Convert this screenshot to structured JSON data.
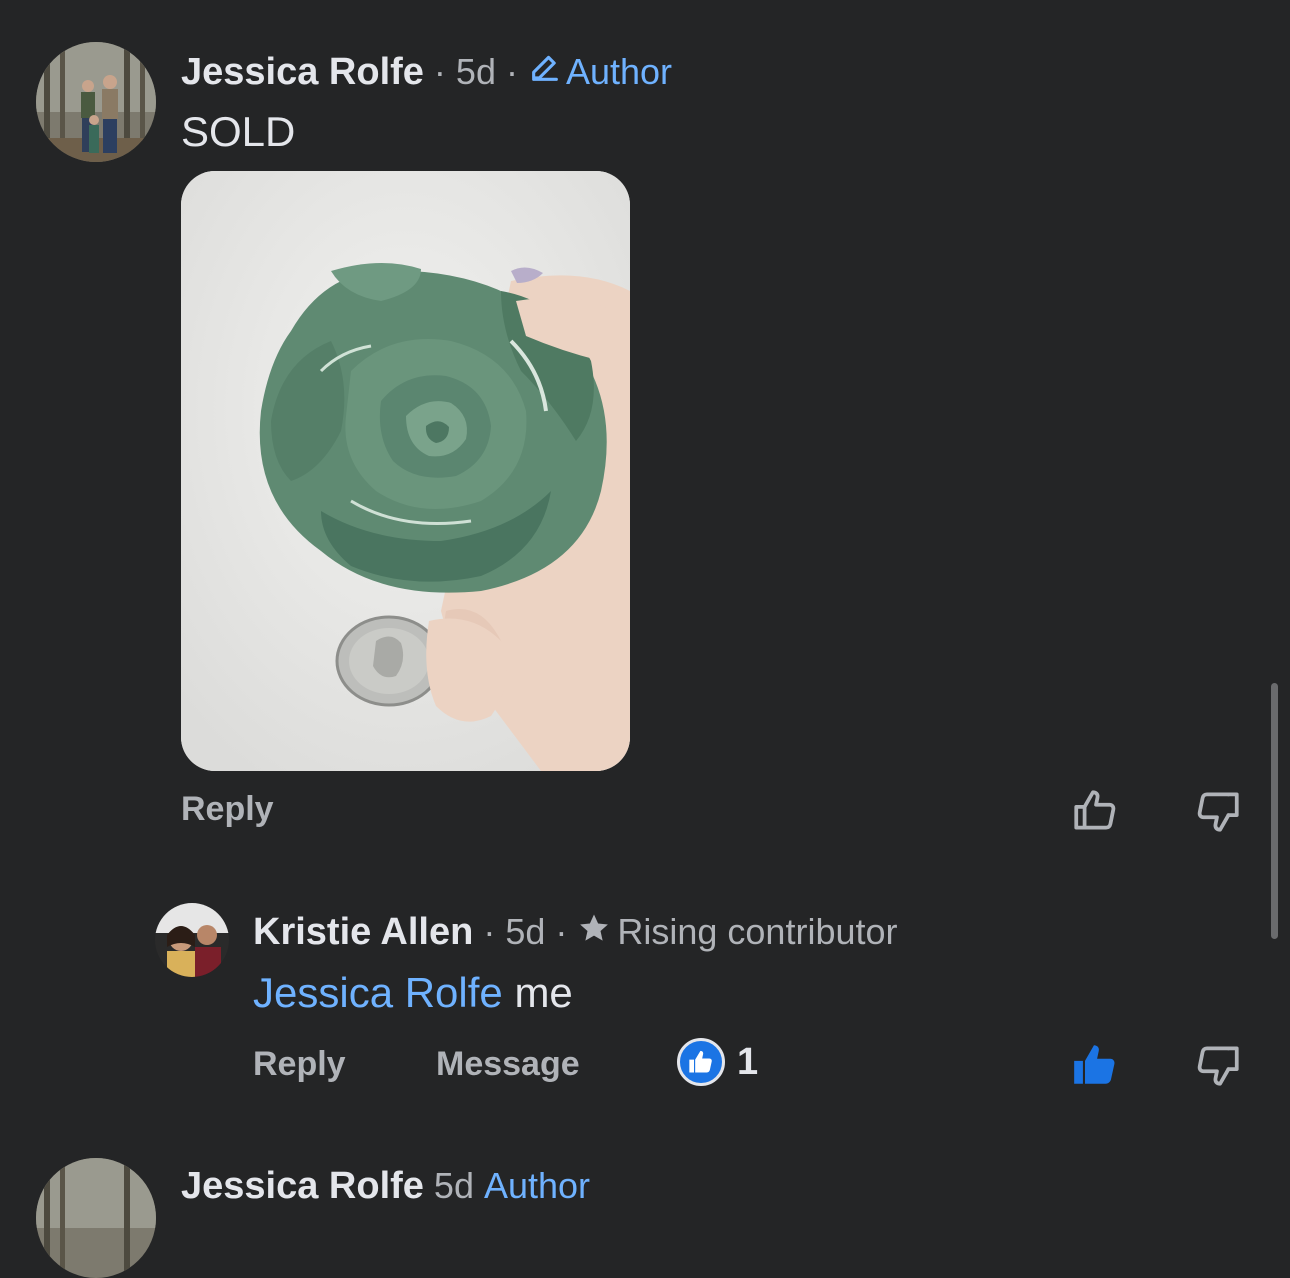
{
  "comments": [
    {
      "author": "Jessica Rolfe",
      "sep1": "·",
      "time": "5d",
      "sep2": "·",
      "badge_label": "Author",
      "badge_icon": "pencil-icon",
      "text": "SOLD",
      "has_photo": true,
      "actions": {
        "reply": "Reply"
      }
    },
    {
      "author": "Kristie Allen",
      "sep1": "·",
      "time": "5d",
      "sep2": "·",
      "badge_label": "Rising contributor",
      "badge_icon": "star-icon",
      "mention": "Jessica Rolfe",
      "text": "me",
      "actions": {
        "reply": "Reply",
        "message": "Message"
      },
      "reaction_count": "1"
    },
    {
      "author": "Jessica Rolfe",
      "time": "5d",
      "badge_label": "Author"
    }
  ],
  "colors": {
    "background": "#242526",
    "accent_blue": "#6fb2ff",
    "like_blue": "#1b74e4",
    "muted": "#b0b3b8"
  },
  "icons": [
    "like-icon",
    "dislike-icon",
    "like-filled-icon",
    "like-reaction-icon"
  ]
}
